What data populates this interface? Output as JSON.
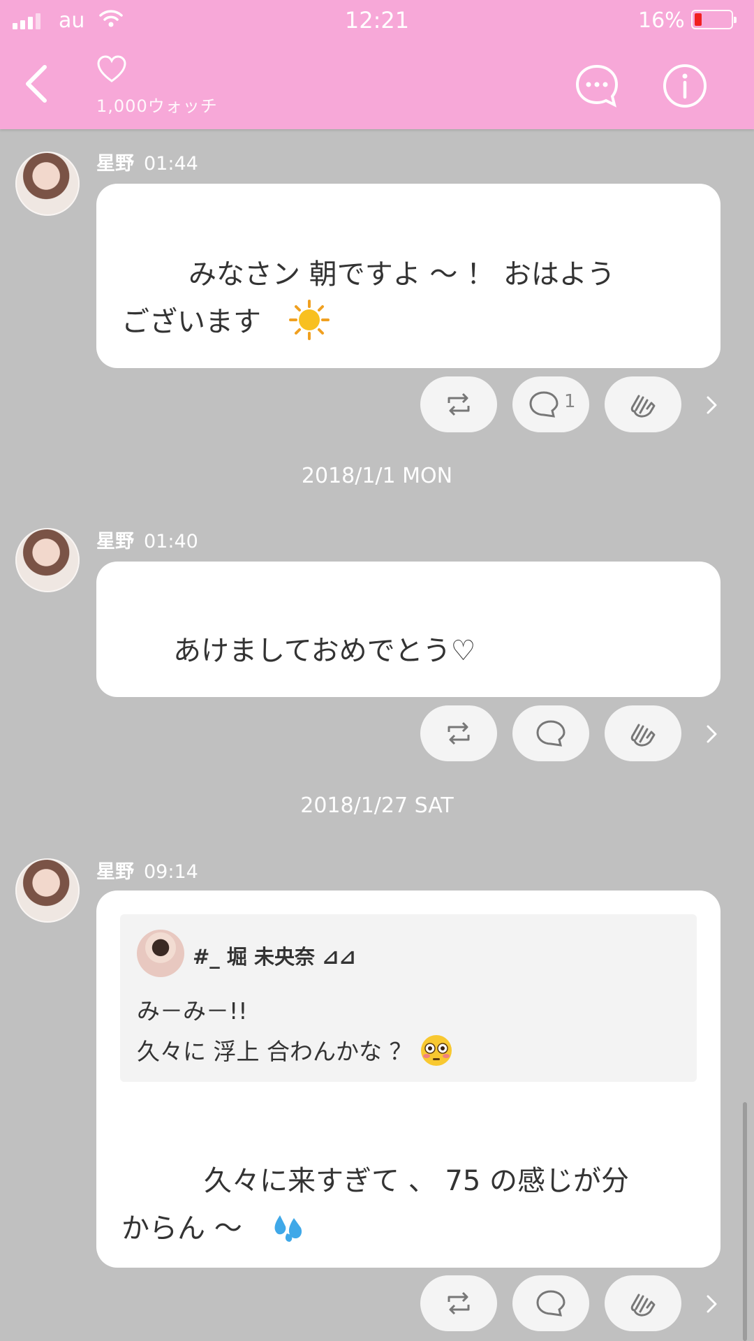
{
  "status": {
    "carrier": "au",
    "time": "12:21",
    "battery": "16%"
  },
  "header": {
    "watch_count": "1,000ウォッチ"
  },
  "posts": [
    {
      "name": "星野",
      "time": "01:44",
      "text": "みなさン 朝ですよ ～ ！ おはよう\nございます",
      "reply_count": "1"
    },
    {
      "date": "2018/1/1 MON",
      "name": "星野",
      "time": "01:40",
      "text": "あけましておめでとう♡"
    },
    {
      "date": "2018/1/27 SAT",
      "name": "星野",
      "time": "09:14",
      "quote": {
        "author": "#_ 堀 未央奈 ⊿⊿",
        "line1": "み－み－!!",
        "line2": "久々に 浮上 合わんかな ？"
      },
      "text": "久々に来すぎて 、 75 の感じが分\nからん ～"
    }
  ],
  "colors": {
    "header_bg": "#f7a8d8",
    "feed_bg": "#c0c0c0",
    "battery_low": "#f02020"
  },
  "icons": [
    "back-chevron-icon",
    "heart-icon",
    "comment-dots-icon",
    "info-icon",
    "retweet-icon",
    "reply-icon",
    "clap-icon",
    "chevron-right-icon",
    "sun-emoji",
    "flushed-emoji",
    "sweat-drops-emoji"
  ]
}
